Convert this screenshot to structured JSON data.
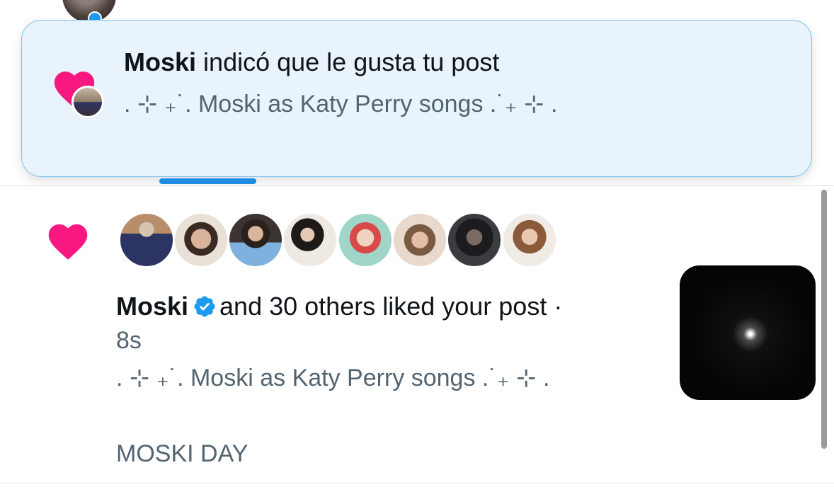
{
  "toast": {
    "user": "Moski",
    "action": "indicó que le gusta tu post",
    "post_title": ". ⊹ ₊˙. Moski as Katy Perry songs .˙₊ ⊹ ."
  },
  "notification": {
    "user": "Moski",
    "action": "and 30 others liked your post ·",
    "time": "8s",
    "post_title": ". ⊹ ₊˙. Moski as Katy Perry songs .˙₊ ⊹ .",
    "post_extra": "MOSKI DAY",
    "liker_count_avatars": 8
  },
  "colors": {
    "heart": "#f91880",
    "verified": "#1d9bf0",
    "toast_bg": "#e8f3fc",
    "toast_border": "#7cc2ee",
    "secondary_text": "#536471"
  },
  "icons": {
    "like": "heart-icon",
    "verified": "verified-badge-icon"
  }
}
